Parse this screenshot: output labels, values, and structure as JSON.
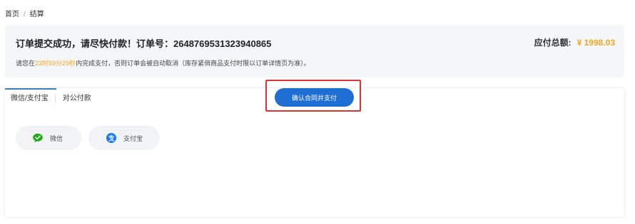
{
  "breadcrumb": {
    "home": "首页",
    "separator": "/",
    "current": "结算"
  },
  "order": {
    "title_prefix": "订单提交成功，请尽快付款！订单号：",
    "order_number": "2648769531323940865",
    "total_label": "应付总额:",
    "total_amount": "¥ 1998.03",
    "note_prefix": "请您在",
    "countdown": "23时59分29秒",
    "note_suffix": "内完成支付，否则订单会被自动取消（库存紧俏商品支付时限以订单详情页为准）。"
  },
  "tabs": [
    {
      "label": "微信/支付宝",
      "active": true
    },
    {
      "label": "对公付款",
      "active": false
    }
  ],
  "payment_methods": [
    {
      "label": "微信",
      "icon": "wechat-icon",
      "color": "#1aad19"
    },
    {
      "label": "支付宝",
      "icon": "alipay-icon",
      "color": "#1677ff"
    }
  ],
  "confirm_button_label": "确认合同并支付",
  "colors": {
    "accent": "#f5a623",
    "primary": "#1f6ed4",
    "highlight_frame": "#e03131"
  }
}
